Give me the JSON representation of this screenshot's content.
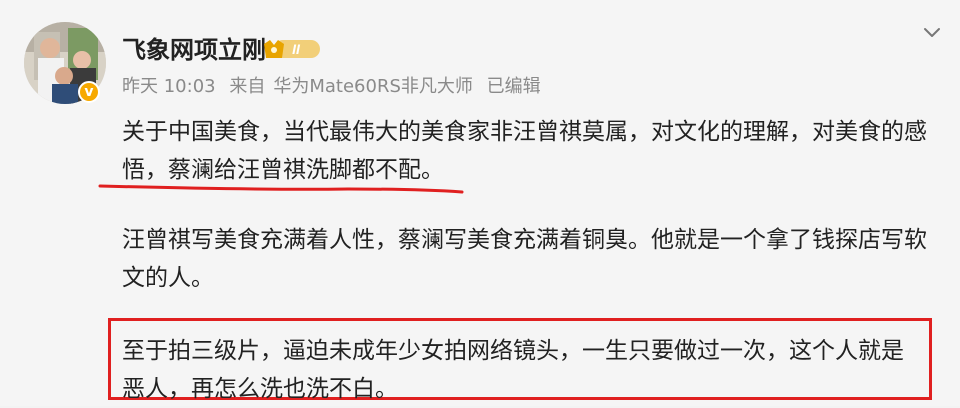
{
  "header": {
    "username": "飞象网项立刚",
    "member_badge": "II",
    "time": "昨天 10:03",
    "source_prefix": "来自",
    "device": "华为Mate60RS非凡大师",
    "edited": "已编辑"
  },
  "avatar": {
    "verified_icon": "verified-badge-icon",
    "verified_symbol": "v"
  },
  "post": {
    "paragraph_1": "关于中国美食，当代最伟大的美食家非汪曾祺莫属，对文化的理解，对美食的感悟，蔡澜给汪曾祺洗脚都不配。",
    "paragraph_2": "汪曾祺写美食充满着人性，蔡澜写美食充满着铜臭。他就是一个拿了钱探店写软文的人。",
    "paragraph_3": "至于拍三级片，逼迫未成年少女拍网络镜头，一生只要做过一次，这个人就是恶人，再怎么洗也洗不白。"
  },
  "colors": {
    "annotation_red": "#e02020",
    "badge_gold": "#f7a900",
    "meta_gray": "#8a8a8a"
  },
  "icons": {
    "more": "chevron-down-icon"
  }
}
